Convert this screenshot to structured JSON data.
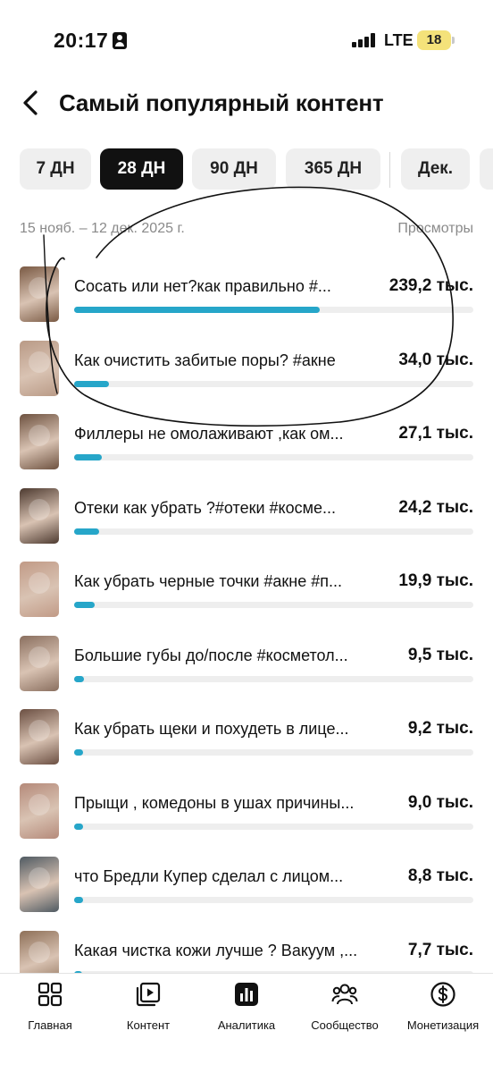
{
  "status_bar": {
    "time": "20:17",
    "network": "LTE",
    "battery": "18",
    "icons": [
      "id-card-icon",
      "signal-icon",
      "battery-icon"
    ]
  },
  "header": {
    "back_icon": "chevron-left-icon",
    "title": "Самый популярный контент"
  },
  "tabs": [
    {
      "label": "7 ДН",
      "active": false
    },
    {
      "label": "28 ДН",
      "active": true
    },
    {
      "label": "90 ДН",
      "active": false
    },
    {
      "label": "365 ДН",
      "active": false
    },
    {
      "label": "Дек.",
      "active": false
    }
  ],
  "date_range": "15 нояб. – 12 дек. 2025 г.",
  "views_header": "Просмотры",
  "items": [
    {
      "title": "Сосать или нет?как правильно #...",
      "views": "239,2 тыс.",
      "progress": 1.0,
      "thumb": "#7a5a44"
    },
    {
      "title": "Как очистить забитые поры? #акне",
      "views": "34,0 тыс.",
      "progress": 0.142,
      "thumb": "#b99a86"
    },
    {
      "title": "Филлеры не омолаживают ,как ом...",
      "views": "27,1 тыс.",
      "progress": 0.113,
      "thumb": "#6e5240"
    },
    {
      "title": "Отеки как убрать ?#отеки #косме...",
      "views": "24,2 тыс.",
      "progress": 0.101,
      "thumb": "#4d3a30"
    },
    {
      "title": "Как убрать черные точки #акне #п...",
      "views": "19,9 тыс.",
      "progress": 0.083,
      "thumb": "#c19a86"
    },
    {
      "title": "Большие губы до/после #косметол...",
      "views": "9,5 тыс.",
      "progress": 0.04,
      "thumb": "#8a6f5f"
    },
    {
      "title": "Как убрать щеки и похудеть в лице...",
      "views": "9,2 тыс.",
      "progress": 0.038,
      "thumb": "#6b4f42"
    },
    {
      "title": "Прыщи , комедоны в ушах причины...",
      "views": "9,0 тыс.",
      "progress": 0.038,
      "thumb": "#b58a7a"
    },
    {
      "title": "что Бредли Купер сделал с лицом...",
      "views": "8,8 тыс.",
      "progress": 0.037,
      "thumb": "#4f5a62"
    },
    {
      "title": "Какая чистка кожи лучше ? Вакуум ,...",
      "views": "7,7 тыс.",
      "progress": 0.032,
      "thumb": "#8e7058"
    }
  ],
  "bottom_nav": [
    {
      "label": "Главная",
      "icon": "home-grid-icon"
    },
    {
      "label": "Контент",
      "icon": "content-play-icon"
    },
    {
      "label": "Аналитика",
      "icon": "analytics-bar-icon"
    },
    {
      "label": "Сообщество",
      "icon": "community-people-icon"
    },
    {
      "label": "Монетизация",
      "icon": "dollar-circle-icon"
    }
  ],
  "colors": {
    "accent": "#26a6c9",
    "active_tab_bg": "#111111",
    "tab_bg": "#efefef",
    "muted_text": "#8a8a8a",
    "battery": "#f4e27a"
  }
}
